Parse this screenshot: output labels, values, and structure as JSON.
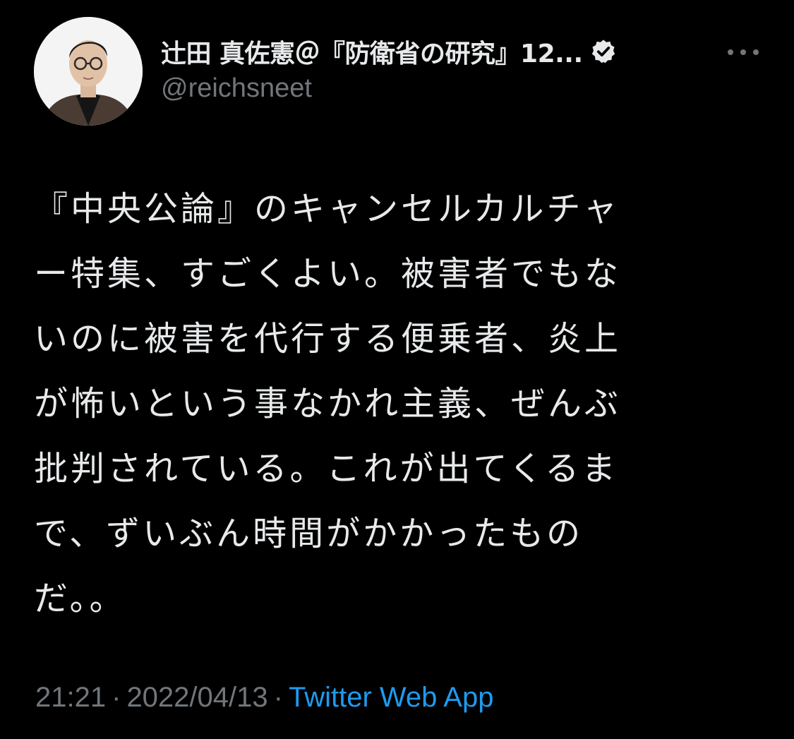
{
  "user": {
    "display_name": "辻田 真佐憲＠『防衛省の研究』12...",
    "handle": "@reichsneet",
    "verified": true,
    "avatar_icon": "profile-photo"
  },
  "tweet": {
    "text": "『中央公論』のキャンセルカルチャー特集、すごくよい。被害者でもないのに被害を代行する便乗者、炎上が怖いという事なかれ主義、ぜんぶ批判されている。これが出てくるまで、ずいぶん時間がかかったものだ。。",
    "lines": [
      "『中央公論』のキャンセルカルチャ",
      "ー特集、すごくよい。被害者でもな",
      "いのに被害を代行する便乗者、炎上",
      "が怖いという事なかれ主義、ぜんぶ",
      "批判されている。これが出てくるま",
      "で、ずいぶん時間がかかったもの",
      "だ。。"
    ],
    "time": "21:21",
    "separator": "·",
    "date": "2022/04/13",
    "source": "Twitter Web App"
  },
  "icons": {
    "verified": "verified-badge-icon",
    "more": "more-options-icon"
  },
  "colors": {
    "background": "#000000",
    "text_primary": "#e7e9ea",
    "text_secondary": "#71767b",
    "link": "#1d9bf0"
  }
}
